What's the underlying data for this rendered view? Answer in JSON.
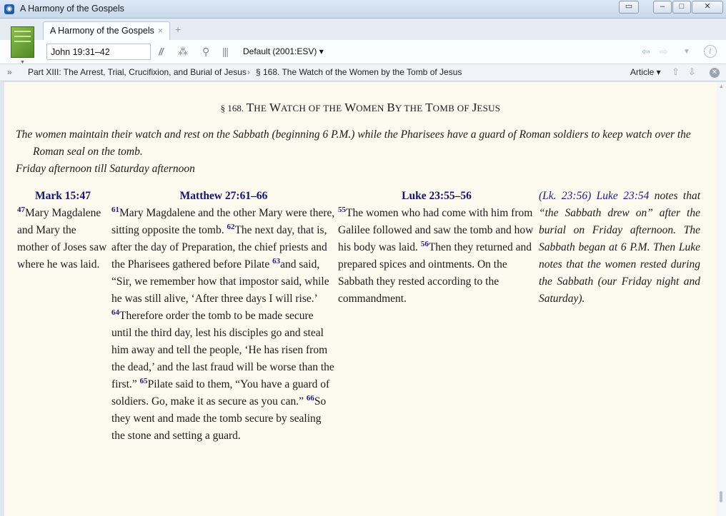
{
  "window": {
    "title": "A Harmony of the Gospels",
    "app_icon": "logos-icon"
  },
  "tabs": [
    {
      "label": "A Harmony of the Gospels",
      "close": "×"
    }
  ],
  "tab_add": "+",
  "toolbar": {
    "reference_value": "John 19:31–42",
    "version": "Default (2001:ESV)"
  },
  "breadcrumb": {
    "expand": "»",
    "part": "Part XIII: The Arrest, Trial, Crucifixion, and Burial of Jesus",
    "separator": "›",
    "section": "§ 168. The Watch of the Women by the Tomb of Jesus",
    "view": "Article"
  },
  "section": {
    "number": "§ 168.",
    "title_parts": [
      [
        "T",
        "HE"
      ],
      [
        "W",
        "ATCH OF THE"
      ],
      [
        "W",
        "OMEN"
      ],
      [
        "B",
        "Y THE"
      ],
      [
        "T",
        "OMB OF"
      ],
      [
        "J",
        "ESUS"
      ]
    ],
    "intro": "The women maintain their watch and rest on the Sabbath (beginning 6 P.M.) while the Pharisees have a guard of Roman soldiers to keep watch over the Roman seal on the tomb.",
    "timing": "Friday afternoon till Saturday afternoon"
  },
  "columns": {
    "mark": {
      "heading": "Mark 15:47",
      "verses": [
        {
          "num": "47",
          "text": "Mary Magdalene and Mary the mother of Joses saw where he was laid."
        }
      ]
    },
    "matthew": {
      "heading": "Matthew 27:61–66",
      "verses": [
        {
          "num": "61",
          "text": "Mary Magdalene and the other Mary were there, sitting opposite the tomb. "
        },
        {
          "num": "62",
          "text": "The next day, that is, after the day of Preparation, the chief priests and the Pharisees gathered before Pilate "
        },
        {
          "num": "63",
          "text": "and said, “Sir, we remember how that impostor said, while he was still alive, ‘After three days I will rise.’ "
        },
        {
          "num": "64",
          "text": "Therefore order the tomb to be made secure until the third day, lest his disciples go and steal him away and tell the people, ‘He has risen from the dead,’ and the last fraud will be worse than the first.” "
        },
        {
          "num": "65",
          "text": "Pilate said to them, “You have a guard of soldiers. Go, make it as secure as you can.” "
        },
        {
          "num": "66",
          "text": "So they went and made the tomb secure by sealing the stone and setting a guard."
        }
      ]
    },
    "luke": {
      "heading": "Luke 23:55–56",
      "verses": [
        {
          "num": "55",
          "text": "The women who had come with him from Galilee followed and saw the tomb and how his body was laid. "
        },
        {
          "num": "56",
          "text": "Then they returned and prepared spices and ointments. On the Sabbath they rested according to the commandment."
        }
      ]
    },
    "note": {
      "ref1": "(Lk. 23:56)",
      "ref2": "Luke 23:54",
      "text": "notes that “the Sabbath drew on” after the burial on Friday afternoon. The Sabbath began at 6 P.M. Then Luke notes that the women rested during the Sabbath (our Friday night and Saturday)."
    }
  },
  "colors": {
    "heading_blue": "#141466",
    "verse_number": "#1c1c80",
    "page_background": "#fdfaf0"
  }
}
